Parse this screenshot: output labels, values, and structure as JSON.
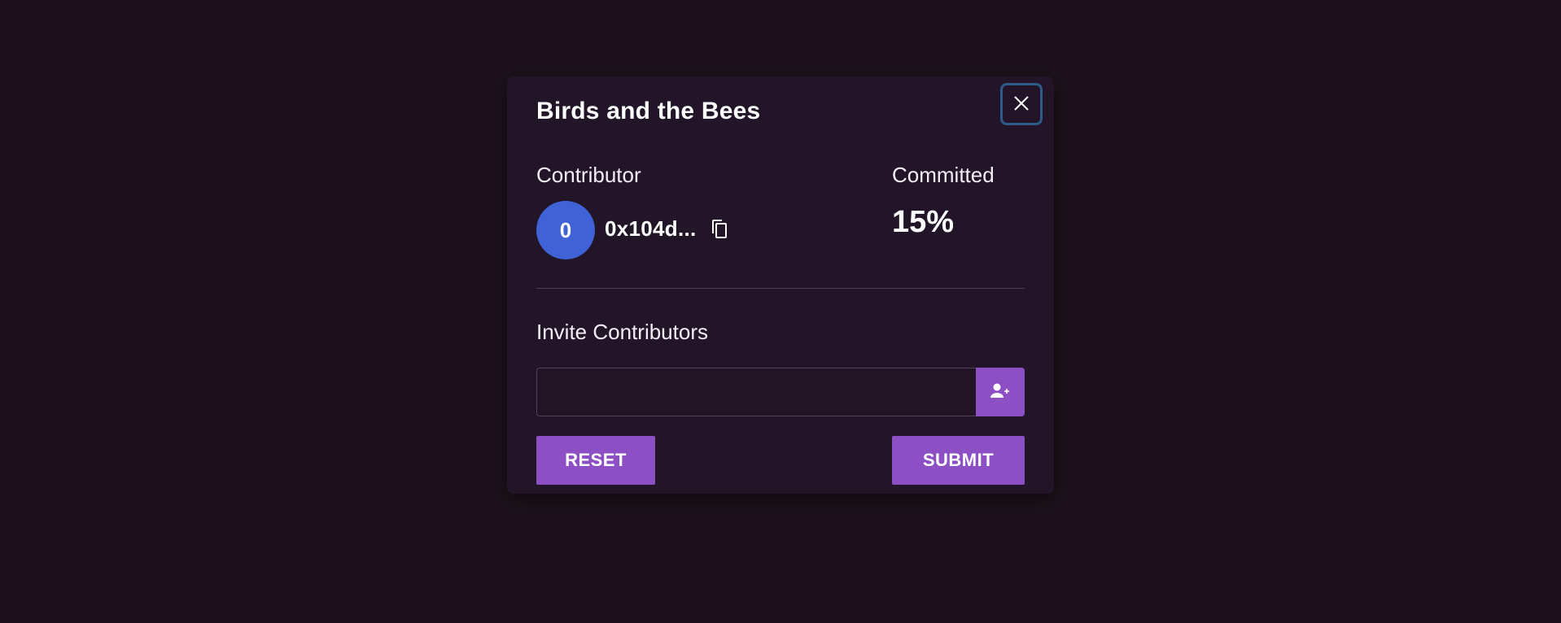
{
  "modal": {
    "title": "Birds and the Bees",
    "close_icon": "close-icon"
  },
  "contributor": {
    "label": "Contributor",
    "avatar_initial": "0",
    "avatar_color": "#3f63d6",
    "address": "0x104d...",
    "copy_icon": "copy-icon"
  },
  "committed": {
    "label": "Committed",
    "value": "15%"
  },
  "invite": {
    "label": "Invite Contributors",
    "input_value": "",
    "input_placeholder": "",
    "add_icon": "add-user-icon"
  },
  "actions": {
    "reset_label": "RESET",
    "submit_label": "SUBMIT"
  },
  "colors": {
    "background": "#1d121c",
    "modal_background": "#221528",
    "accent": "#8d4fc4",
    "focus_ring": "#2e5a8c"
  }
}
